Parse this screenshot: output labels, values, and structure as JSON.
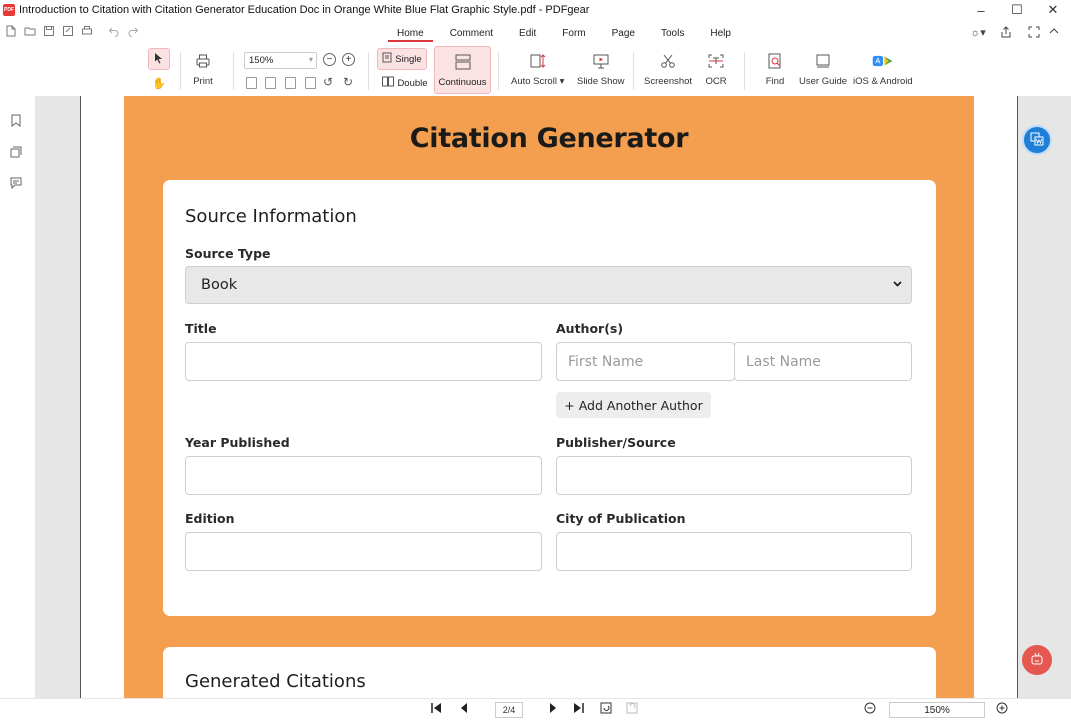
{
  "window": {
    "title": "Introduction to Citation with Citation Generator Education Doc in Orange White Blue Flat Graphic Style.pdf - PDFgear",
    "logo_text": "PDF",
    "controls": [
      "–",
      "☐",
      "✕"
    ]
  },
  "menu": {
    "tabs": [
      {
        "label": "Home",
        "active": true
      },
      {
        "label": "Comment",
        "active": false
      },
      {
        "label": "Edit",
        "active": false
      },
      {
        "label": "Form",
        "active": false
      },
      {
        "label": "Page",
        "active": false
      },
      {
        "label": "Tools",
        "active": false
      },
      {
        "label": "Help",
        "active": false
      }
    ]
  },
  "toolbar": {
    "print_label": "Print",
    "zoom_value": "150%",
    "single_label": "Single",
    "double_label": "Double",
    "continuous_label": "Continuous",
    "auto_scroll_label": "Auto Scroll",
    "slide_show_label": "Slide Show",
    "screenshot_label": "Screenshot",
    "ocr_label": "OCR",
    "find_label": "Find",
    "user_guide_label": "User Guide",
    "ios_android_label": "iOS & Android"
  },
  "document": {
    "title": "Citation Generator",
    "source_info": {
      "heading": "Source Information",
      "source_type_label": "Source Type",
      "source_type_value": "Book",
      "title_label": "Title",
      "authors_label": "Author(s)",
      "first_name_placeholder": "First Name",
      "last_name_placeholder": "Last Name",
      "add_author_label": "+ Add Another Author",
      "year_label": "Year Published",
      "publisher_label": "Publisher/Source",
      "edition_label": "Edition",
      "city_label": "City of Publication"
    },
    "generated": {
      "heading": "Generated Citations"
    }
  },
  "statusbar": {
    "page_indicator": "2/4",
    "zoom_value": "150%"
  },
  "colors": {
    "accent": "#d9363e",
    "page_orange": "#f39f4f",
    "float_blue": "#1f7fd6",
    "float_red": "#e5584f"
  }
}
